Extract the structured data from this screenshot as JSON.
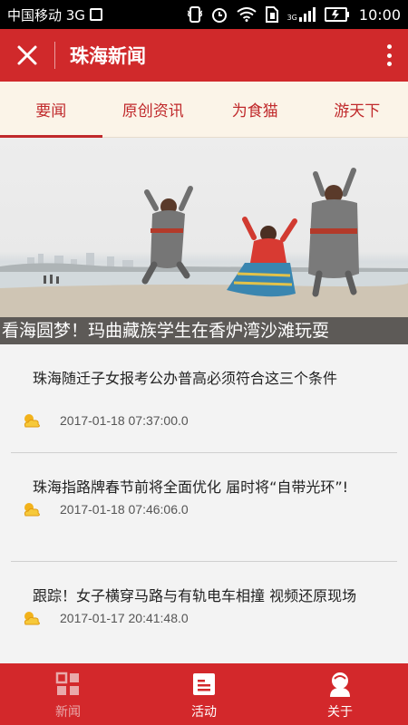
{
  "status_bar": {
    "carrier": "中国移动 3G",
    "network_label": "3G",
    "time": "10:00"
  },
  "header": {
    "title": "珠海新闻"
  },
  "tabs": [
    {
      "label": "要闻",
      "active": true
    },
    {
      "label": "原创资讯",
      "active": false
    },
    {
      "label": "为食猫",
      "active": false
    },
    {
      "label": "游天下",
      "active": false
    }
  ],
  "hero": {
    "caption": "看海圆梦！玛曲藏族学生在香炉湾沙滩玩耍"
  },
  "news": [
    {
      "title": "珠海随迁子女报考公办普高必须符合这三个条件",
      "date": "2017-01-18 07:37:00.0"
    },
    {
      "title": "珠海指路牌春节前将全面优化 届时将“自带光环”!",
      "date": "2017-01-18 07:46:06.0"
    },
    {
      "title": "跟踪！女子横穿马路与有轨电车相撞 视频还原现场",
      "date": "2017-01-17 20:41:48.0"
    }
  ],
  "bottom_nav": [
    {
      "label": "新闻",
      "icon": "grid-icon"
    },
    {
      "label": "活动",
      "icon": "calendar-icon"
    },
    {
      "label": "关于",
      "icon": "person-icon"
    }
  ],
  "colors": {
    "brand_red": "#d0292b",
    "tab_bg": "#fbf4e8",
    "tab_text": "#c0292b"
  }
}
